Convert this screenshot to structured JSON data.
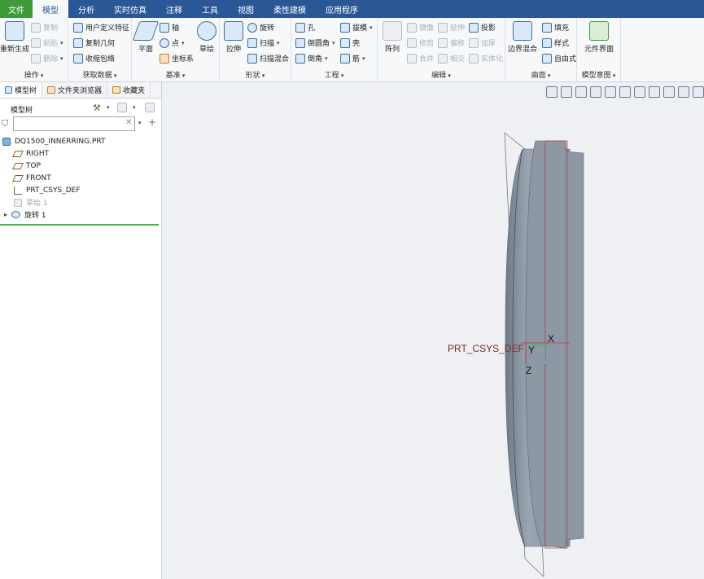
{
  "tabs": [
    "文件",
    "模型",
    "分析",
    "实时仿真",
    "注释",
    "工具",
    "视图",
    "柔性建模",
    "应用程序"
  ],
  "active_tab": "模型",
  "ribbon": {
    "operations": {
      "label": "操作",
      "regenerate": "重新生成",
      "copy": "复制",
      "paste": "粘贴",
      "delete": "删除"
    },
    "get_data": {
      "label": "获取数据",
      "udf": "用户定义特征",
      "copy_geom": "复制几何",
      "shrinkwrap": "收缩包络"
    },
    "datum": {
      "label": "基准",
      "plane": "平面",
      "axis": "轴",
      "point": "点",
      "csys": "坐标系",
      "sketch": "草绘"
    },
    "shapes": {
      "label": "形状",
      "extrude": "拉伸",
      "revolve": "旋转",
      "sweep": "扫描",
      "swept_blend": "扫描混合"
    },
    "engineering": {
      "label": "工程",
      "hole": "孔",
      "draft": "拔模",
      "round": "倒圆角",
      "shell": "壳",
      "chamfer": "倒角",
      "rib": "筋"
    },
    "editing": {
      "label": "编辑",
      "pattern": "阵列",
      "mirror": "镜像",
      "extend": "延伸",
      "project": "投影",
      "trim": "修剪",
      "offset": "偏移",
      "thicken": "加厚",
      "merge": "合并",
      "intersect": "相交",
      "solidify": "实体化"
    },
    "surfaces": {
      "label": "曲面",
      "boundary_blend": "边界混合",
      "fill": "填充",
      "style": "样式",
      "freestyle": "自由式"
    },
    "model_intent": {
      "label": "模型意图",
      "component_interface": "元件界面"
    }
  },
  "panel": {
    "tabs": [
      "模型树",
      "文件夹浏览器",
      "收藏夹"
    ],
    "tree_label": "模型树",
    "filter_placeholder": "",
    "items": [
      {
        "label": "DQ1500_INNERRING.PRT",
        "icon": "part-icon"
      },
      {
        "label": "RIGHT",
        "icon": "datum-plane-icon"
      },
      {
        "label": "TOP",
        "icon": "datum-plane-icon"
      },
      {
        "label": "FRONT",
        "icon": "datum-plane-icon"
      },
      {
        "label": "PRT_CSYS_DEF",
        "icon": "csys-icon"
      },
      {
        "label": "草绘 1",
        "icon": "sketch-icon"
      },
      {
        "label": "旋转 1",
        "icon": "revolve-icon"
      }
    ]
  },
  "viewport": {
    "csys_label": "PRT_CSYS_DEF",
    "axis_x": "X",
    "axis_y": "Y",
    "axis_z": "Z"
  }
}
